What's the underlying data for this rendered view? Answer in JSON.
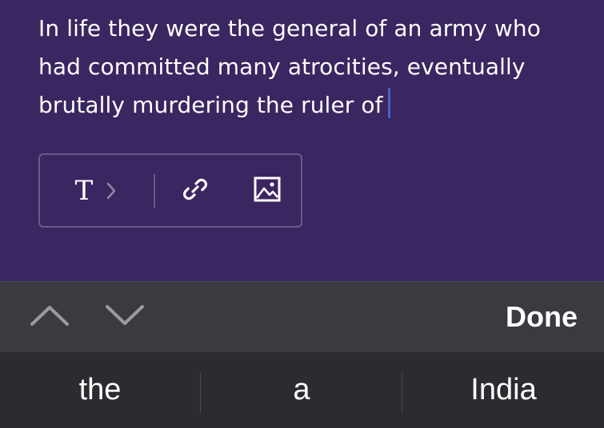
{
  "editor": {
    "text": "In life they were the general of an army who had committed many atrocities, eventually brutally murdering the ruler of"
  },
  "toolbar": {
    "text_style_glyph": "T",
    "icons": [
      "text-style-icon",
      "chevron-right-icon",
      "link-icon",
      "image-icon"
    ]
  },
  "accessory": {
    "done_label": "Done",
    "icons": [
      "chevron-up-icon",
      "chevron-down-icon"
    ]
  },
  "suggestions": [
    "the",
    "a",
    "India"
  ],
  "colors": {
    "background": "#3a2660",
    "accessory_bar": "#3b3a40",
    "suggestion_bar": "#2c2b30",
    "caret": "#4a63c8",
    "toolbar_border": "#6a5a8c"
  }
}
